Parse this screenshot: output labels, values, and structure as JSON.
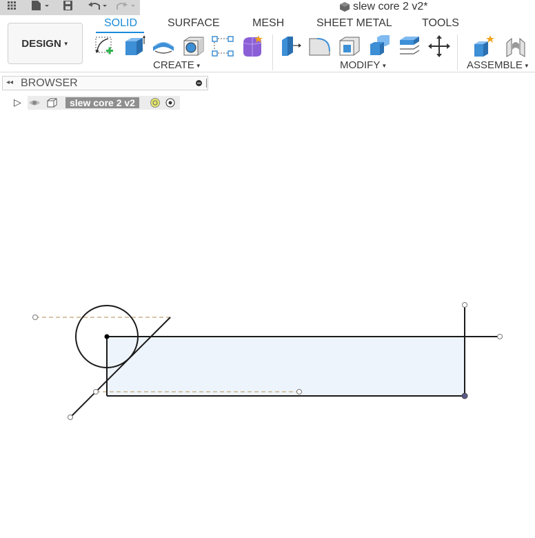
{
  "document": {
    "title": "slew core 2 v2*",
    "icon": "component-cube-icon"
  },
  "quick_access": [
    {
      "name": "apps-grid-icon"
    },
    {
      "name": "file-icon"
    },
    {
      "name": "save-icon"
    },
    {
      "name": "undo-icon"
    },
    {
      "name": "redo-icon"
    }
  ],
  "workspace": {
    "label": "DESIGN"
  },
  "tabs": [
    {
      "label": "SOLID",
      "active": true
    },
    {
      "label": "SURFACE"
    },
    {
      "label": "MESH"
    },
    {
      "label": "SHEET METAL"
    },
    {
      "label": "TOOLS"
    }
  ],
  "groups": {
    "create": "CREATE",
    "modify": "MODIFY",
    "assemble": "ASSEMBLE"
  },
  "browser": {
    "title": "BROWSER",
    "root_component": "slew core 2 v2"
  },
  "colors": {
    "accent": "#1b8bd9",
    "sketch_line": "#1a1a1a",
    "construction_line": "#c8b48a",
    "profile_fill": "#eef4fb"
  }
}
